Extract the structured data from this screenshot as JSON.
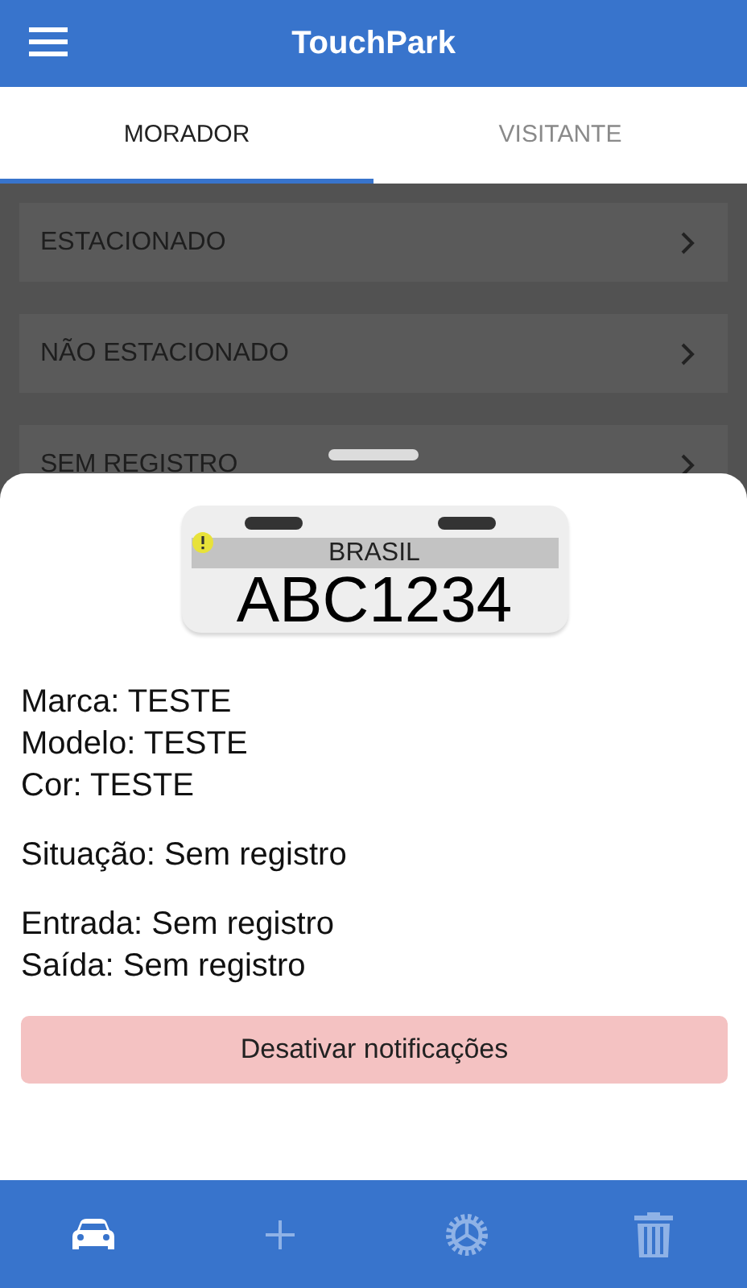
{
  "app_bar": {
    "title": "TouchPark"
  },
  "tabs": [
    {
      "label": "MORADOR",
      "selected": true
    },
    {
      "label": "VISITANTE",
      "selected": false
    }
  ],
  "list": [
    {
      "label": "ESTACIONADO"
    },
    {
      "label": "NÃO ESTACIONADO"
    },
    {
      "label": "SEM REGISTRO"
    }
  ],
  "sheet": {
    "plate": {
      "country": "BRASIL",
      "number": "ABC1234"
    },
    "groups": [
      [
        "Marca: TESTE",
        "Modelo: TESTE",
        "Cor: TESTE"
      ],
      [
        "Situação: Sem registro"
      ],
      [
        "Entrada: Sem registro",
        "Saída: Sem registro"
      ]
    ],
    "button": "Desativar notificações"
  },
  "bottom_nav": [
    {
      "kind": "car",
      "selected": true
    },
    {
      "kind": "plus",
      "selected": false
    },
    {
      "kind": "gear",
      "selected": false
    },
    {
      "kind": "trash",
      "selected": false
    }
  ]
}
